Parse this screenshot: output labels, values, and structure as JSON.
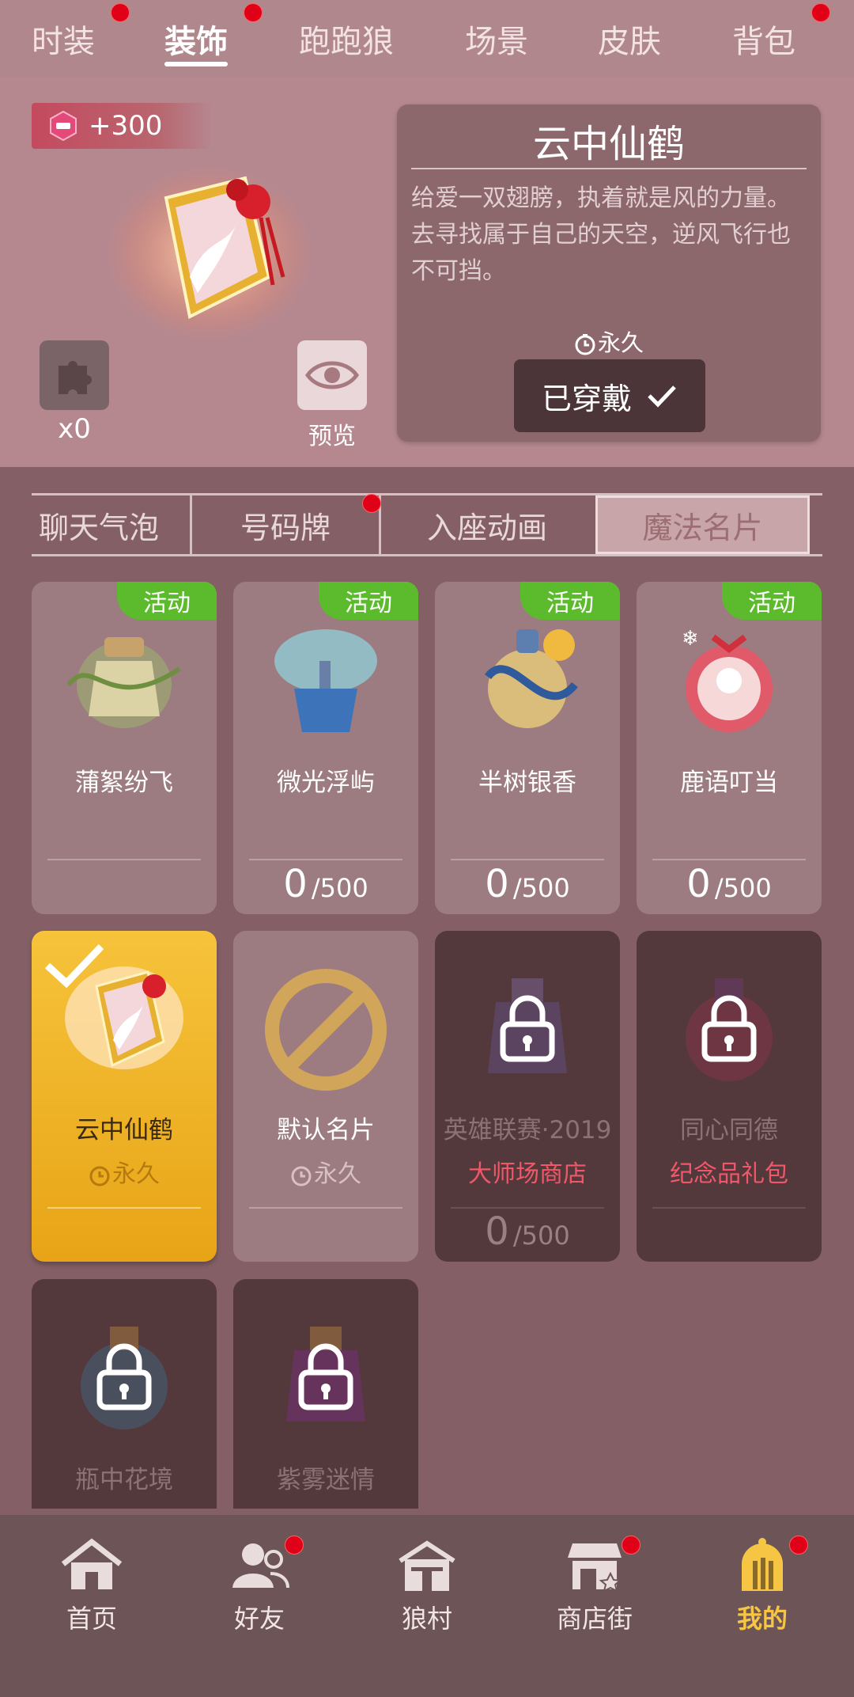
{
  "top_tabs": [
    {
      "label": "时装",
      "dot": true
    },
    {
      "label": "装饰",
      "dot": true,
      "active": true
    },
    {
      "label": "跑跑狼",
      "dot": false
    },
    {
      "label": "场景",
      "dot": false
    },
    {
      "label": "皮肤",
      "dot": false
    },
    {
      "label": "背包",
      "dot": true
    }
  ],
  "hero": {
    "points": "+300",
    "puzzle_count": "x0",
    "preview_label": "预览",
    "item_title": "云中仙鹤",
    "item_desc": "给爱一双翅膀，执着就是风的力量。去寻找属于自己的天空，逆风飞行也不可挡。",
    "duration": "永久",
    "equip_button": "已穿戴"
  },
  "sub_tabs": [
    {
      "label": "聊天气泡"
    },
    {
      "label": "号码牌",
      "dot": true
    },
    {
      "label": "入座动画"
    },
    {
      "label": "魔法名片",
      "active": true
    }
  ],
  "cards": [
    {
      "name": "蒲絮纷飞",
      "tag": "活动",
      "state": "light",
      "progress": null
    },
    {
      "name": "微光浮屿",
      "tag": "活动",
      "state": "light",
      "progress": {
        "current": "0",
        "max": "/500"
      }
    },
    {
      "name": "半树银香",
      "tag": "活动",
      "state": "light",
      "progress": {
        "current": "0",
        "max": "/500"
      }
    },
    {
      "name": "鹿语叮当",
      "tag": "活动",
      "state": "light",
      "progress": {
        "current": "0",
        "max": "/500"
      }
    },
    {
      "name": "云中仙鹤",
      "sub": "永久",
      "state": "selected"
    },
    {
      "name": "默认名片",
      "sub": "永久",
      "state": "light"
    },
    {
      "name": "英雄联赛·2019",
      "sub": "大师场商店",
      "state": "locked",
      "progress": {
        "current": "0",
        "max": "/500"
      }
    },
    {
      "name": "同心同德",
      "sub": "纪念品礼包",
      "state": "locked"
    },
    {
      "name": "瓶中花境",
      "state": "locked"
    },
    {
      "name": "紫雾迷情",
      "state": "locked"
    }
  ],
  "bottom_nav": [
    {
      "label": "首页",
      "icon": "home-icon",
      "dot": false
    },
    {
      "label": "好友",
      "icon": "friends-icon",
      "dot": true
    },
    {
      "label": "狼村",
      "icon": "village-icon",
      "dot": false
    },
    {
      "label": "商店街",
      "icon": "shop-icon",
      "dot": true
    },
    {
      "label": "我的",
      "icon": "profile-icon",
      "dot": true,
      "active": true
    }
  ],
  "colors": {
    "accent_gold": "#f6c544",
    "tag_green": "#5cbb2c",
    "red_dot": "#e00018",
    "source_red": "#f0586a"
  }
}
